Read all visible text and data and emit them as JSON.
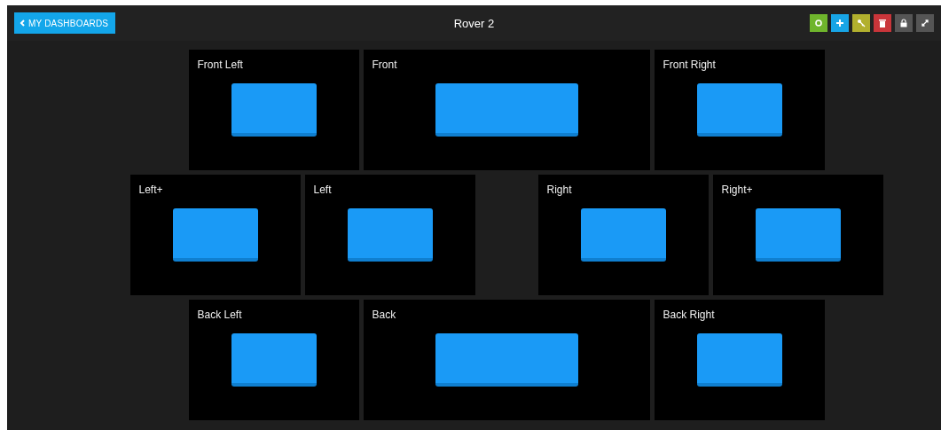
{
  "header": {
    "back_button": "MY DASHBOARDS",
    "title": "Rover 2",
    "tools": [
      {
        "kind": "settings",
        "color": "#6fb52c"
      },
      {
        "kind": "add",
        "color": "#18a5e6"
      },
      {
        "kind": "key",
        "color": "#b2b02e"
      },
      {
        "kind": "delete",
        "color": "#c9353a"
      },
      {
        "kind": "lock",
        "color": "#555555"
      },
      {
        "kind": "expand",
        "color": "#555555"
      }
    ]
  },
  "rows": [
    {
      "tiles": [
        {
          "label": "Front Left",
          "kind": "small"
        },
        {
          "label": "Front",
          "kind": "wide"
        },
        {
          "label": "Front Right",
          "kind": "small"
        }
      ]
    },
    {
      "tiles": [
        {
          "label": "Left+",
          "kind": "small"
        },
        {
          "label": "Left",
          "kind": "small"
        },
        {
          "label": "Right",
          "kind": "small"
        },
        {
          "label": "Right+",
          "kind": "small"
        }
      ]
    },
    {
      "tiles": [
        {
          "label": "Back Left",
          "kind": "small"
        },
        {
          "label": "Back",
          "kind": "wide"
        },
        {
          "label": "Back Right",
          "kind": "small"
        }
      ]
    }
  ]
}
